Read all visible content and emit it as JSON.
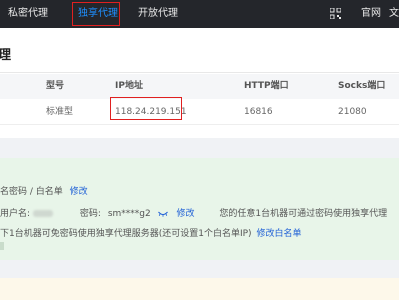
{
  "nav": {
    "items": [
      "私密代理",
      "独享代理",
      "开放代理"
    ],
    "active": "独享代理",
    "right_items": [
      "官网",
      "文档"
    ],
    "accent_color": "#1e90ff",
    "highlight_color": "#e02020"
  },
  "page": {
    "title": "理"
  },
  "table": {
    "columns": [
      "型号",
      "IP地址",
      "HTTP端口",
      "Socks端口"
    ],
    "rows": [
      {
        "model": "标准型",
        "ip": "118.24.219.151",
        "http_port": "16816",
        "socks_port": "21080"
      }
    ]
  },
  "auth": {
    "heading": "名密码 / 白名单",
    "heading_link": "修改",
    "user_label": "用户名:",
    "password_label": "密码:",
    "password_value": "sm****g2",
    "password_link": "修改",
    "password_note": "您的任意1台机器可通过密码使用独享代理",
    "whitelist_note": "下1台机器可免密码使用独享代理服务器(还可设置1个白名单IP)",
    "whitelist_link": "修改白名单"
  },
  "icons": [
    "qr-code-icon",
    "eye-icon"
  ]
}
